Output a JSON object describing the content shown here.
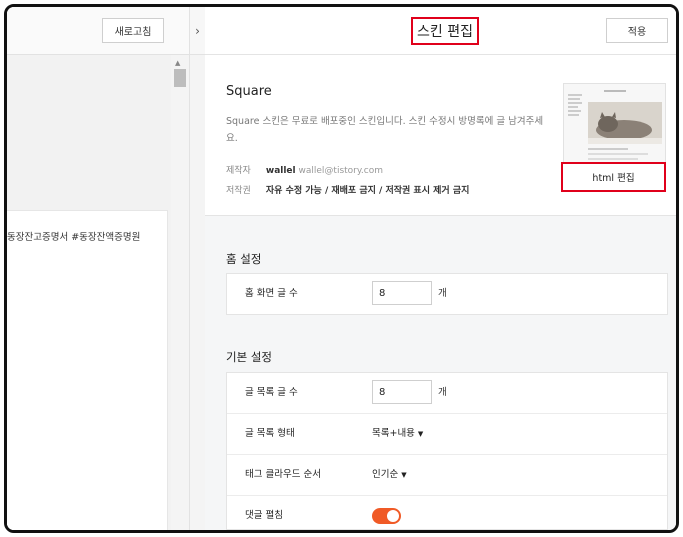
{
  "left_pane": {
    "refresh_label": "새로고침",
    "preview_tags": "동장잔고증명서  #동장잔액증명원"
  },
  "collapse_icon": "chevron-right-icon",
  "collapse_glyph": "›",
  "panel": {
    "title": "스킨 편집",
    "apply_label": "적용"
  },
  "skin": {
    "name": "Square",
    "description": "Square 스킨은 무료로 배포중인 스킨입니다. 스킨 수정시 방명록에 글 남겨주세요.",
    "author_label": "제작자",
    "author_name": "wallel",
    "author_email": "wallel@tistory.com",
    "license_label": "저작권",
    "license_text": "자유 수정 가능 / 재배포 금지 / 저작권 표시 제거 금지",
    "html_edit_label": "html 편집"
  },
  "home_settings": {
    "title": "홈 설정",
    "rows": [
      {
        "label": "홈 화면 글 수",
        "value": "8",
        "unit": "개"
      }
    ]
  },
  "basic_settings": {
    "title": "기본 설정",
    "post_count": {
      "label": "글 목록 글 수",
      "value": "8",
      "unit": "개"
    },
    "list_type": {
      "label": "글 목록 형태",
      "value": "목록+내용"
    },
    "tag_order": {
      "label": "태그 클라우드 순서",
      "value": "인기순"
    },
    "comment_expand": {
      "label": "댓글 펼침",
      "enabled": true
    }
  },
  "colors": {
    "highlight": "#e0001b",
    "toggle_on": "#f05a26"
  }
}
